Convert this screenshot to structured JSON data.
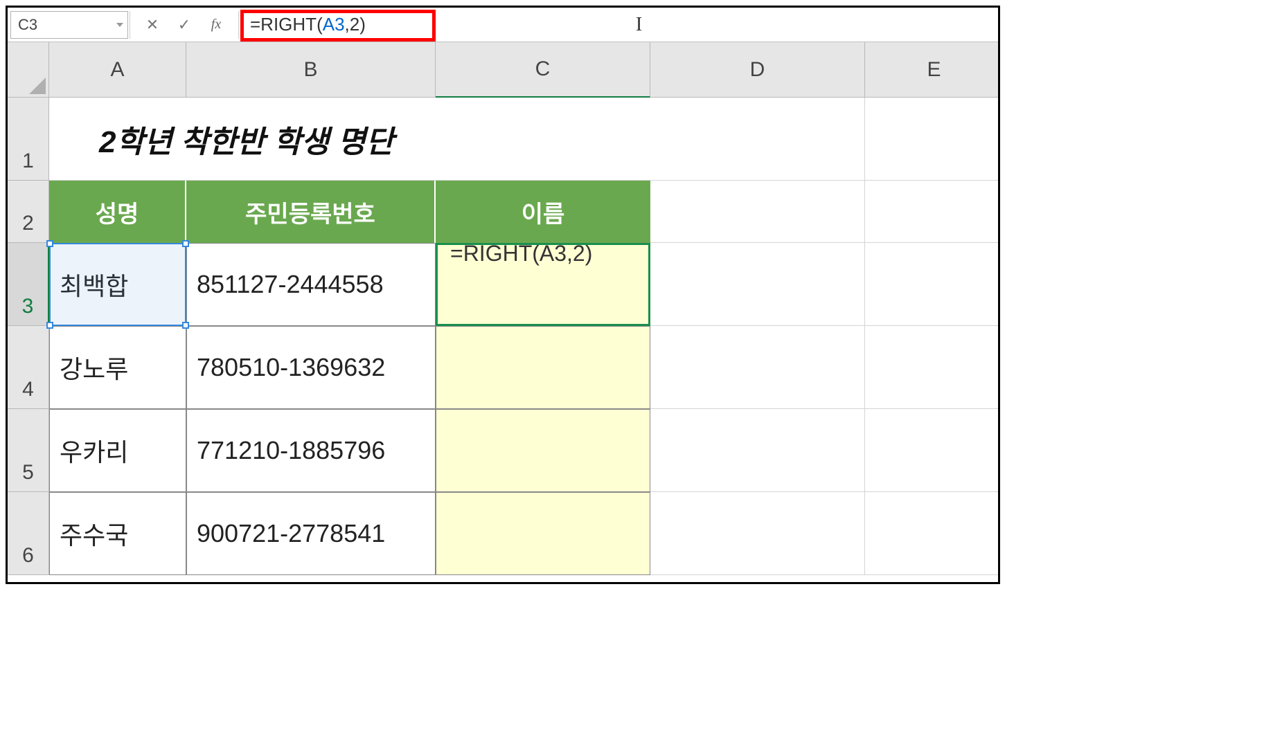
{
  "name_box": "C3",
  "formula_bar": {
    "prefix": "=RIGHT(",
    "ref": "A3",
    "suffix": ",2)",
    "full": "=RIGHT(A3,2)",
    "fx_label": "fx",
    "cancel_icon": "✕",
    "enter_icon": "✓"
  },
  "columns": [
    "A",
    "B",
    "C",
    "D",
    "E"
  ],
  "rows": [
    "1",
    "2",
    "3",
    "4",
    "5",
    "6"
  ],
  "title": "2학년 착한반 학생 명단",
  "headers": {
    "A": "성명",
    "B": "주민등록번호",
    "C": "이름"
  },
  "data": [
    {
      "name": "최백합",
      "ssn": "851127-2444558",
      "c": "=RIGHT(A3,2)"
    },
    {
      "name": "강노루",
      "ssn": "780510-1369632",
      "c": ""
    },
    {
      "name": "우카리",
      "ssn": "771210-1885796",
      "c": ""
    },
    {
      "name": "주수국",
      "ssn": "900721-2778541",
      "c": ""
    }
  ],
  "colors": {
    "header_bg": "#6aa84f",
    "highlight_red": "#ff0000",
    "ref_blue": "#3388dd",
    "active_green": "#1a8f4d",
    "yellow_fill": "#ffffd4"
  },
  "layout": {
    "col_widths": {
      "gutter": 60,
      "A": 198,
      "B": 360,
      "C": 310,
      "D": 310,
      "E": 200
    },
    "row_heights": {
      "header": 80,
      "1": 120,
      "2": 90,
      "3": 120,
      "4": 120,
      "5": 120,
      "6": 120
    }
  }
}
